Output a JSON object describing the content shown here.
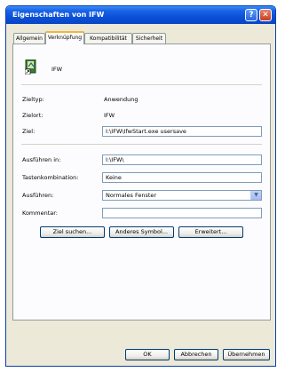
{
  "window": {
    "title": "Eigenschaften von IFW",
    "help_glyph": "?",
    "close_glyph": "✕"
  },
  "tabs": [
    {
      "label": "Allgemein"
    },
    {
      "label": "Verknüpfung"
    },
    {
      "label": "Kompatibilität"
    },
    {
      "label": "Sicherheit"
    }
  ],
  "active_tab": "Verknüpfung",
  "shortcut": {
    "name": "IFW",
    "icon": "shortcut-app-icon",
    "target_type_label": "Zieltyp:",
    "target_type_value": "Anwendung",
    "target_location_label": "Zielort:",
    "target_location_value": "IFW",
    "target_label": "Ziel:",
    "target_value": "I:\\IFW\\IfwStart.exe usersave",
    "start_in_label": "Ausführen in:",
    "start_in_value": "I:\\IFW\\",
    "hotkey_label": "Tastenkombination:",
    "hotkey_value": "Keine",
    "run_label": "Ausführen:",
    "run_value": "Normales Fenster",
    "comment_label": "Kommentar:",
    "comment_value": ""
  },
  "buttons": {
    "find_target": "Ziel suchen...",
    "change_icon": "Anderes Symbol...",
    "advanced": "Erweitert...",
    "ok": "OK",
    "cancel": "Abbrechen",
    "apply": "Übernehmen"
  },
  "colors": {
    "titlebar": "#0a50d8",
    "dialog_bg": "#ece9d8",
    "active_tab_accent": "#f2b53b"
  }
}
